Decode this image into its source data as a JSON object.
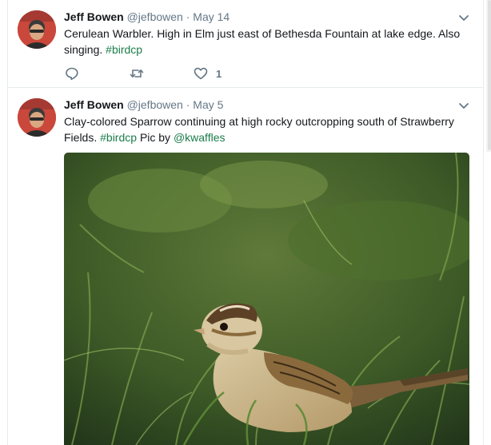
{
  "tweets": [
    {
      "author_name": "Jeff Bowen",
      "handle": "@jefbowen",
      "separator": "·",
      "date": "May 14",
      "text_main": "Cerulean Warbler. High in Elm just east of Bethesda Fountain at lake edge. Also singing.",
      "hashtag": "#birdcp",
      "like_count": "1",
      "icons": {
        "reply": "reply-icon",
        "retweet": "retweet-icon",
        "like": "heart-icon",
        "more": "chevron-down-icon"
      }
    },
    {
      "author_name": "Jeff Bowen",
      "handle": "@jefbowen",
      "separator": "·",
      "date": "May 5",
      "text_main": "Clay-colored Sparrow continuing at high rocky outcropping south of Strawberry Fields.",
      "hashtag": "#birdcp",
      "text_mid": "Pic by",
      "mention": "@kwaffles",
      "icons": {
        "more": "chevron-down-icon"
      }
    }
  ],
  "colors": {
    "link": "#1b7d4a",
    "secondary_text": "#657786",
    "primary_text": "#14171a",
    "divider": "#e6ecf0"
  }
}
